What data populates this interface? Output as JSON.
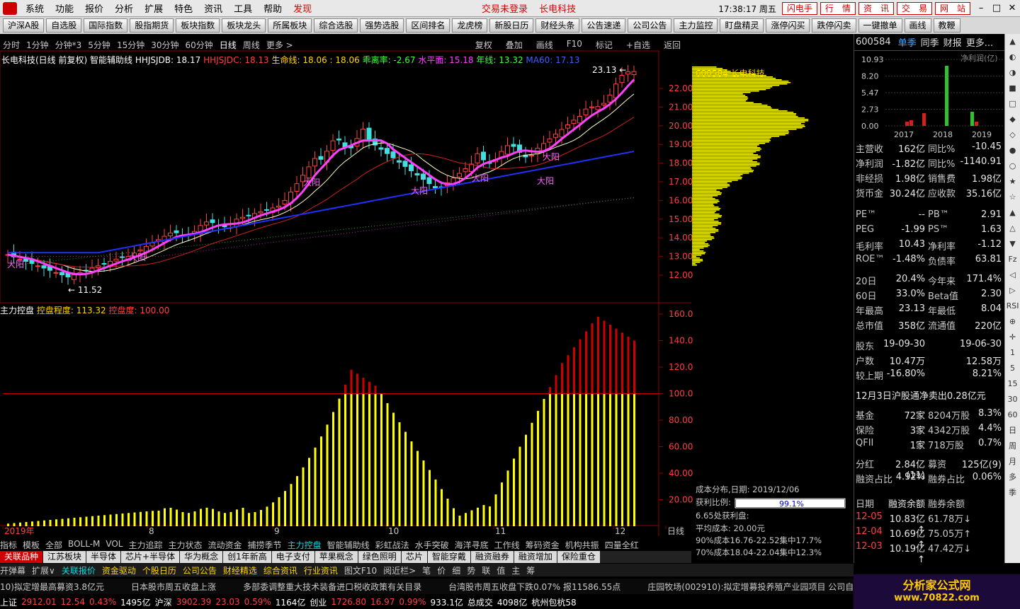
{
  "menubar": {
    "items": [
      "系统",
      "功能",
      "报价",
      "分析",
      "扩展",
      "特色",
      "资讯",
      "工具",
      "帮助",
      "发现"
    ],
    "center": [
      "交易未登录",
      "长电科技"
    ],
    "clock": "17:38:17 周五",
    "buttons": [
      "闪电手",
      "行　情",
      "资　讯",
      "交　易",
      "网　站"
    ]
  },
  "toolbar": [
    "沪深A股",
    "自选股",
    "国际指数",
    "股指期货",
    "板块指数",
    "板块龙头",
    "所属板块",
    "综合选股",
    "强势选股",
    "区间排名",
    "龙虎榜",
    "新股日历",
    "财经头条",
    "公告速递",
    "公司公告",
    "主力监控",
    "盯盘精灵",
    "涨停闪买",
    "跌停闪卖",
    "一键撤单",
    "画线",
    "教鞭"
  ],
  "periods": [
    "分时",
    "1分钟",
    "分钟*3",
    "5分钟",
    "15分钟",
    "30分钟",
    "60分钟",
    "日线",
    "周线",
    "更多 >"
  ],
  "active_period": "日线",
  "chart_tools": [
    "复权",
    "叠加",
    "画线",
    "F10",
    "标记",
    "+自选",
    "返回"
  ],
  "stock_header": {
    "code": "600584",
    "name": "长电科技"
  },
  "info": {
    "title": "长电科技(日线 前复权) 智能辅助线",
    "hhjsjdb": "HHJSJDB: 18.17",
    "hhjsjdc": "HHJSJDC: 18.13",
    "lifeline": "生命线: 18.06 : 18.06",
    "deviation": "乖离率: -2.67",
    "level": "水平面: 15.18",
    "yearline": "年线: 13.32",
    "ma60": "MA60: 17.13"
  },
  "sub_info": {
    "name": "主力控盘",
    "degree": "控盘程度: 113.32",
    "ctrl": "控盘度: 100.00"
  },
  "main_axis": [
    "22.00",
    "21.00",
    "20.00",
    "19.00",
    "18.00",
    "17.00",
    "16.00",
    "15.00",
    "14.00",
    "13.00",
    "12.00"
  ],
  "sub_axis": [
    "160.0",
    "140.0",
    "120.0",
    "100.0",
    "80.00",
    "60.00",
    "40.00",
    "20.00"
  ],
  "date_axis": [
    "2019年",
    "8",
    "9",
    "10",
    "11",
    "12",
    "日线"
  ],
  "annotations": {
    "high": "23.13",
    "low": "11.52",
    "dayang": [
      "大阳",
      "大阳",
      "大阳",
      "大阳",
      "大阳",
      "大阳",
      "大阳"
    ]
  },
  "cost_dist": {
    "date": "成本分布,日期: 2019/12/06",
    "profit_label": "获利比例:",
    "profit_value": "99.1%",
    "profit_at": "6.65处获利盘:",
    "avg": "平均成本: 20.00元",
    "c90": "90%成本16.76-22.52集中17.7%",
    "c70": "70%成本18.04-22.04集中12.3%"
  },
  "rpanel": {
    "code": "600584",
    "tabs": [
      "单季",
      "同季",
      "财报",
      "更多..."
    ],
    "profit_chart": {
      "y": [
        "10.93",
        "8.20",
        "5.47",
        "2.73",
        "0.00"
      ],
      "x": [
        "2017",
        "2018",
        "2019"
      ],
      "label": "净利润(亿)"
    },
    "fin": [
      [
        "主营收",
        "162亿",
        "同比%",
        "-10.45"
      ],
      [
        "净利润",
        "-1.82亿",
        "同比%",
        "-1140.91"
      ],
      [
        "非经损",
        "1.98亿",
        "销售费",
        "1.98亿"
      ],
      [
        "货币金",
        "30.24亿",
        "应收款",
        "35.16亿"
      ],
      [
        "PE™",
        "--",
        "PB™",
        "2.91"
      ],
      [
        "PEG",
        "-1.99",
        "PS™",
        "1.63"
      ],
      [
        "毛利率",
        "10.43",
        "净利率",
        "-1.12"
      ],
      [
        "ROE™",
        "-1.48%",
        "负债率",
        "63.81"
      ],
      [
        "20日",
        "20.4%",
        "今年来",
        "171.4%"
      ],
      [
        "60日",
        "33.0%",
        "Beta值",
        "2.30"
      ],
      [
        "年最高",
        "23.13",
        "年最低",
        "8.04"
      ],
      [
        "总市值",
        "358亿",
        "流通值",
        "220亿"
      ],
      [
        "股东",
        "19-09-30",
        "",
        "19-06-30"
      ],
      [
        "户数",
        "10.47万",
        "",
        "12.58万"
      ],
      [
        "较上期",
        "-16.80%",
        "",
        "8.21%"
      ]
    ],
    "news": "12月3日沪股通净卖出0.28亿元",
    "funds": [
      [
        "基金",
        "72家",
        "8204万股",
        "8.3%"
      ],
      [
        "保险",
        "3家",
        "4342万股",
        "4.4%"
      ],
      [
        "QFII",
        "1家",
        "718万股",
        "0.7%"
      ]
    ],
    "misc": [
      [
        "分红",
        "2.84亿(11)",
        "募资",
        "125亿(9)"
      ],
      [
        "融资占比",
        "4.92%",
        "融券占比",
        "0.06%"
      ]
    ],
    "margin_hdr": [
      "日期",
      "融资余额",
      "融券余额"
    ],
    "margin": [
      [
        "12-05",
        "10.83亿↑",
        "61.78万↓"
      ],
      [
        "12-04",
        "10.69亿↑",
        "75.05万↑"
      ],
      [
        "12-03",
        "10.19亿↑",
        "47.42万↓"
      ]
    ]
  },
  "vtools": [
    "▲",
    "◐",
    "◑",
    "■",
    "□",
    "◆",
    "◇",
    "●",
    "○",
    "★",
    "☆",
    "▲",
    "△",
    "▼",
    "Fz",
    "◁",
    "▷",
    "RSI",
    "⊕",
    "✛",
    "1",
    "5",
    "15",
    "30",
    "60",
    "日",
    "周",
    "月",
    "多",
    "季"
  ],
  "bottom_tabs": [
    "指标",
    "模板",
    "全部",
    "BOLL-M",
    "VOL",
    "主力追踪",
    "主力状态",
    "流动资金",
    "捕捞季节",
    "主力控盘",
    "智能辅助线",
    "彩虹战法",
    "水手突破",
    "海洋寻底",
    "工作线",
    "筹码资金",
    "机构共振",
    "四量全红"
  ],
  "active_tab": "主力控盘",
  "tags": [
    "关联品种",
    "江苏板块",
    "半导体",
    "芯片+半导体",
    "华为概念",
    "创1年新高",
    "电子支付",
    "苹果概念",
    "绿色照明",
    "芯片",
    "智能穿戴",
    "融资融券",
    "融资增加",
    "保险重仓"
  ],
  "bar3": [
    "开弹幕",
    "扩展∨",
    "关联报价",
    "资金驱动",
    "个股日历",
    "公司公告",
    "财经精选",
    "综合资讯",
    "行业资讯",
    "图文F10",
    "阅近栏>",
    "笔",
    "价",
    "细",
    "势",
    "联",
    "值",
    "主",
    "筹"
  ],
  "ticker": [
    "10)拟定增最高募资3.8亿元",
    "日本股市周五收盘上涨",
    "多部委调整重大技术装备进口税收政策有关目录",
    "台湾股市周五收盘下跌0.07% 报11586.55点",
    "庄园牧场(002910):拟定增募投养殖产业园项目 公司自有奶"
  ],
  "status": {
    "sh": "上证",
    "sh_v": "2912.01",
    "sh_c": "12.54",
    "sh_p": "0.43%",
    "sh_a": "1495亿",
    "sz": "沪深",
    "sz_v": "3902.39",
    "sz_c": "23.03",
    "sz_p": "0.59%",
    "sz_a": "1164亿",
    "cy": "创业",
    "cy_v": "1726.80",
    "cy_c": "16.97",
    "cy_p": "0.99%",
    "cy_a": "933.1亿",
    "total": "总成交",
    "total_v": "4098亿",
    "loc": "杭州包杭58"
  },
  "logoad": {
    "title": "分析家公式网",
    "url": "www.70822.com"
  },
  "colors": {
    "up": "#ff4040",
    "down": "#40ff40",
    "accent": "#00e0e0",
    "bar_yellow": "#ffff00",
    "bar_red": "#d00000"
  }
}
